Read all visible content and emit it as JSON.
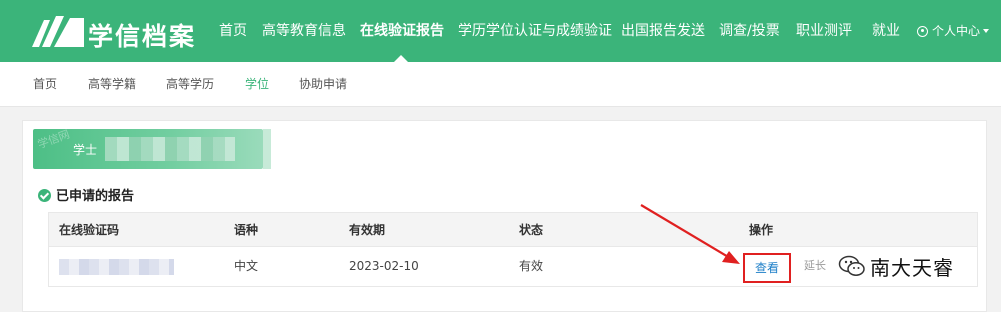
{
  "brand": {
    "name": "学信档案",
    "logo_icon": "chsi-wings-logo"
  },
  "nav": {
    "items": [
      {
        "label": "首页"
      },
      {
        "label": "高等教育信息"
      },
      {
        "label": "在线验证报告",
        "active": true
      },
      {
        "label": "学历学位认证与成绩验证"
      },
      {
        "label": "出国报告发送"
      },
      {
        "label": "调查/投票"
      },
      {
        "label": "职业测评"
      },
      {
        "label": "就业"
      }
    ],
    "user_menu": {
      "label": "个人中心",
      "icon": "user-circle-icon"
    }
  },
  "subnav": {
    "items": [
      {
        "label": "首页"
      },
      {
        "label": "高等学籍"
      },
      {
        "label": "高等学历"
      },
      {
        "label": "学位",
        "active": true
      },
      {
        "label": "协助申请"
      }
    ]
  },
  "degree": {
    "label": "学士",
    "watermark": "学信网"
  },
  "reports": {
    "section_title": "已申请的报告",
    "columns": [
      "在线验证码",
      "语种",
      "有效期",
      "状态",
      "操作"
    ],
    "rows": [
      {
        "language": "中文",
        "expiry": "2023-02-10",
        "status": "有效",
        "actions": {
          "view": "查看",
          "extend": "延长"
        }
      }
    ]
  },
  "overlay": {
    "watermark_text": "南大天睿",
    "highlight_color": "#e02020"
  },
  "colors": {
    "brand_green": "#3bb47a",
    "link_blue": "#1e7fc8"
  }
}
